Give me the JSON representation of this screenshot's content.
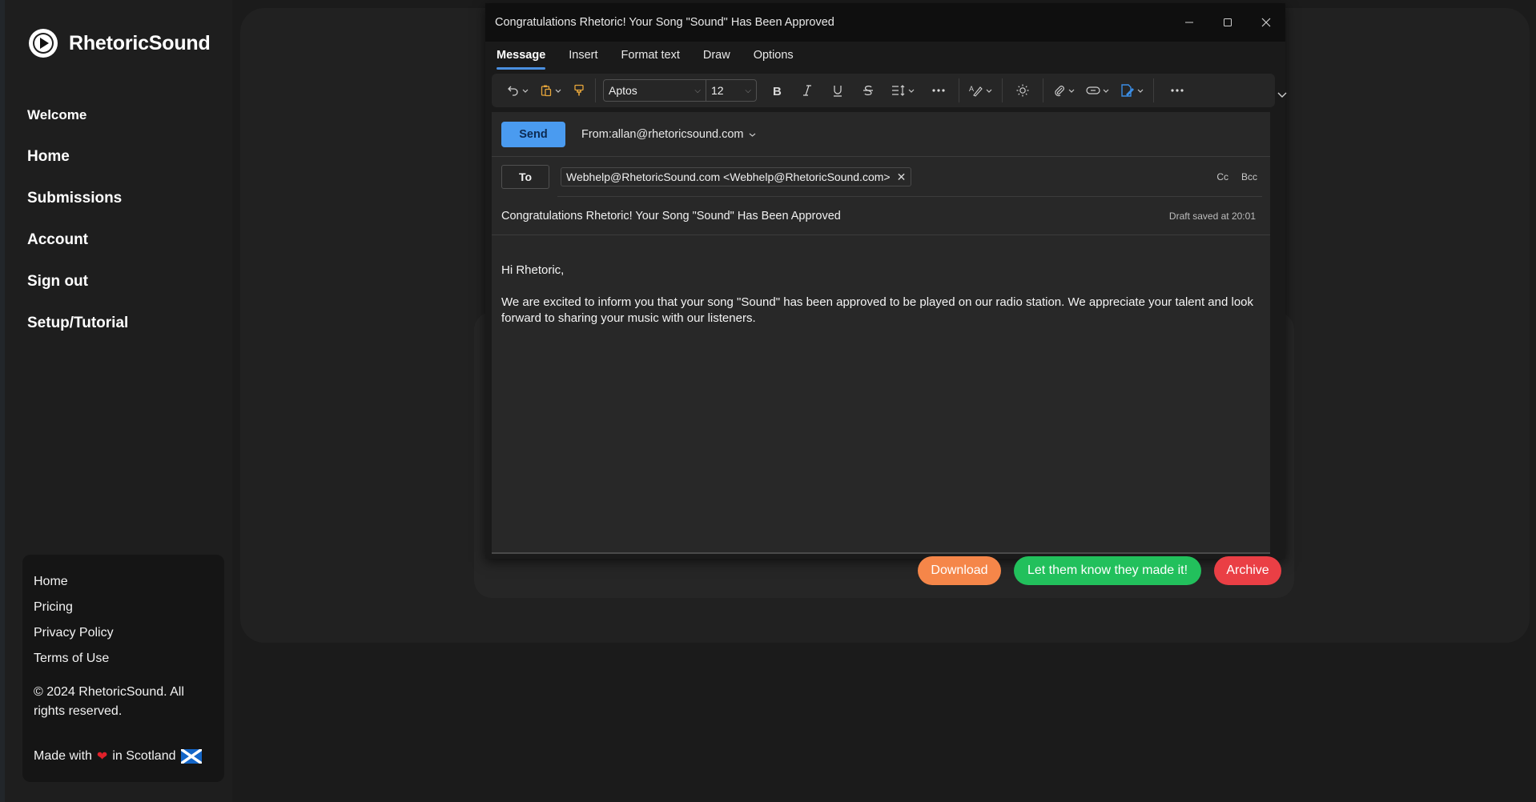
{
  "sidebar": {
    "brand": "RhetoricSound",
    "nav": [
      {
        "label": "Welcome"
      },
      {
        "label": "Home"
      },
      {
        "label": "Submissions"
      },
      {
        "label": "Account"
      },
      {
        "label": "Sign out"
      },
      {
        "label": "Setup/Tutorial"
      }
    ],
    "footer": {
      "links": [
        "Home",
        "Pricing",
        "Privacy Policy",
        "Terms of Use"
      ],
      "copyright": "© 2024 RhetoricSound. All rights reserved.",
      "made_with_prefix": "Made with",
      "made_with_suffix": "in Scotland",
      "heart": "❤"
    }
  },
  "compose": {
    "window_title": "Congratulations Rhetoric! Your Song \"Sound\" Has Been Approved",
    "tabs": [
      {
        "label": "Message",
        "active": true
      },
      {
        "label": "Insert"
      },
      {
        "label": "Format text"
      },
      {
        "label": "Draw"
      },
      {
        "label": "Options"
      }
    ],
    "toolbar": {
      "font_name": "Aptos",
      "font_size": "12"
    },
    "send_label": "Send",
    "from_label": "From:",
    "from_address": "allan@rhetoricsound.com",
    "to_label": "To",
    "recipient": "Webhelp@RhetoricSound.com <Webhelp@RhetoricSound.com>",
    "cc_label": "Cc",
    "bcc_label": "Bcc",
    "subject": "Congratulations Rhetoric! Your Song \"Sound\" Has Been Approved",
    "draft_status": "Draft saved at 20:01",
    "body": {
      "greeting": "Hi Rhetoric,",
      "paragraph": "We are excited to inform you that your song \"Sound\" has been approved to be played on our radio station. We appreciate your talent and look forward to sharing your music with our listeners."
    }
  },
  "actions": {
    "download": "Download",
    "notify": "Let them know they made it!",
    "archive": "Archive"
  },
  "colors": {
    "send": "#4a9bf0",
    "download": "#f58649",
    "notify": "#22c05c",
    "archive": "#ea3f45",
    "tab_underline": "#4a8fe0"
  }
}
